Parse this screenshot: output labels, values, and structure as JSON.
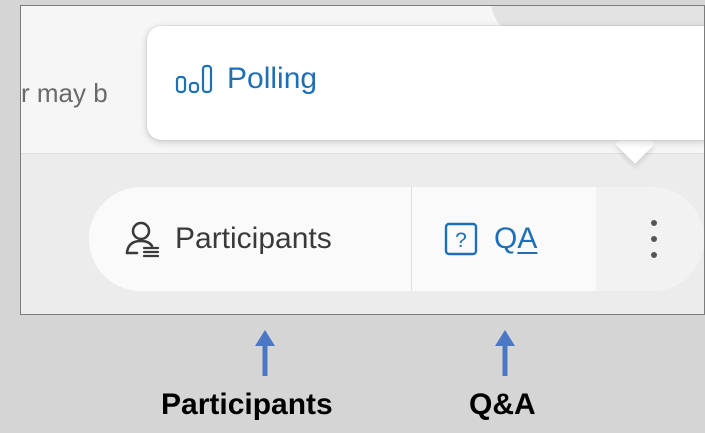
{
  "background_text": "r may b",
  "popup": {
    "items": [
      {
        "label": "Polling",
        "icon": "poll-chart-icon"
      }
    ]
  },
  "controls": {
    "participants": {
      "label": "Participants",
      "icon": "participants-icon"
    },
    "qa": {
      "label_prefix": "Q",
      "label_mnemonic": "A",
      "icon": "question-box-icon"
    },
    "more": {
      "icon": "more-vertical-icon"
    }
  },
  "annotations": {
    "participants_caption": "Participants",
    "qa_caption": "Q&A"
  },
  "colors": {
    "accent": "#1e6fb5",
    "annotation_arrow": "#4a78c4"
  }
}
